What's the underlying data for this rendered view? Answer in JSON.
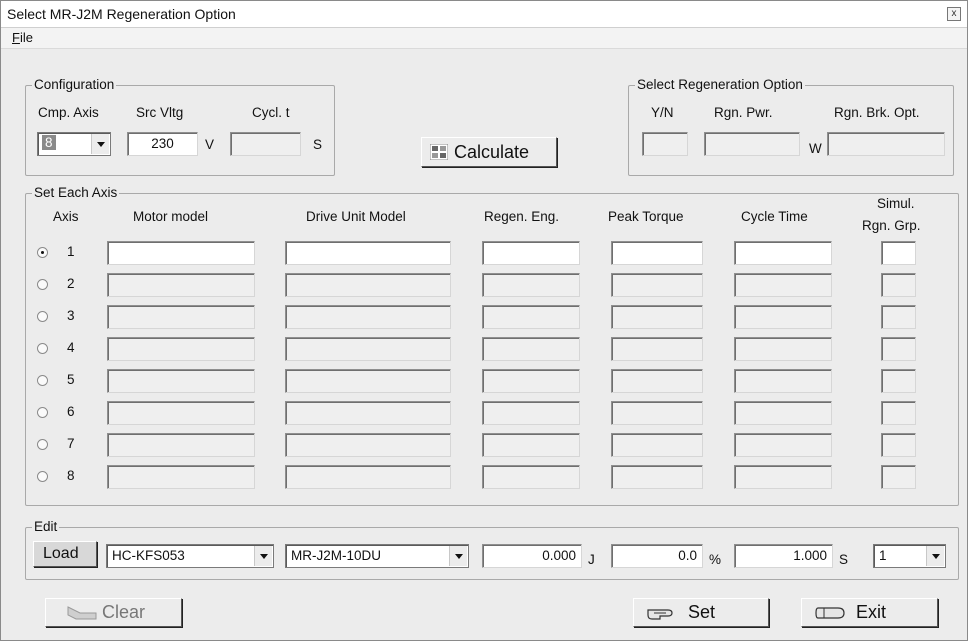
{
  "window": {
    "title": "Select MR-J2M Regeneration Option",
    "close_glyph": "x"
  },
  "menu": {
    "file_accel": "F",
    "file_rest": "ile"
  },
  "configuration": {
    "legend": "Configuration",
    "cmp_axis_label": "Cmp. Axis",
    "src_vltg_label": "Src Vltg",
    "cycl_t_label": "Cycl. t",
    "cmp_axis_value": "8",
    "src_vltg_value": "230",
    "src_vltg_unit": "V",
    "cycl_t_value": "",
    "cycl_t_unit": "S"
  },
  "calculate": {
    "label": "Calculate"
  },
  "regen_option": {
    "legend": "Select Regeneration Option",
    "yn_label": "Y/N",
    "rgn_pwr_label": "Rgn. Pwr.",
    "rgn_brk_label": "Rgn. Brk. Opt.",
    "rgn_pwr_unit": "W",
    "yn_value": "",
    "rgn_pwr_value": "",
    "rgn_brk_value": ""
  },
  "set_each_axis": {
    "legend": "Set Each Axis",
    "headers": {
      "axis": "Axis",
      "motor": "Motor model",
      "drive": "Drive Unit Model",
      "regen": "Regen. Eng.",
      "peak": "Peak Torque",
      "cycle": "Cycle Time",
      "simul1": "Simul.",
      "simul2": "Rgn. Grp."
    },
    "axes": [
      "1",
      "2",
      "3",
      "4",
      "5",
      "6",
      "7",
      "8"
    ],
    "selected_axis": "1"
  },
  "edit": {
    "legend": "Edit",
    "load_label": "Load",
    "motor_value": "HC-KFS053",
    "drive_value": "MR-J2M-10DU",
    "regen_value": "0.000",
    "regen_unit": "J",
    "peak_value": "0.0",
    "peak_unit": "%",
    "cycle_value": "1.000",
    "cycle_unit": "S",
    "grp_value": "1"
  },
  "buttons": {
    "clear": "Clear",
    "set": "Set",
    "exit": "Exit"
  }
}
